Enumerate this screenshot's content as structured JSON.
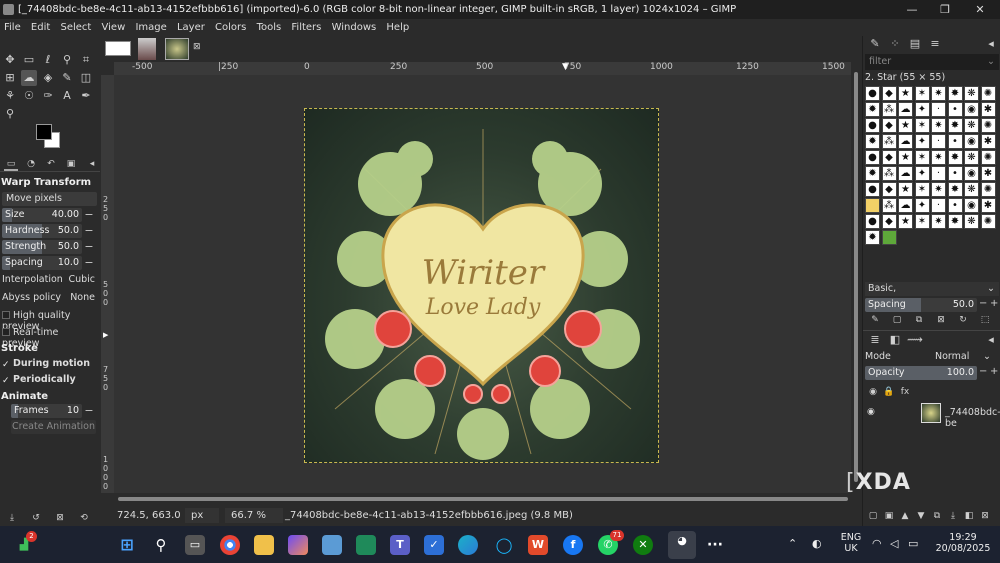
{
  "window": {
    "title": "[_74408bdc-be8e-4c11-ab13-4152efbbb616] (imported)-6.0 (RGB color 8-bit non-linear integer, GIMP built-in sRGB, 1 layer) 1024x1024 – GIMP",
    "minimize_icon": "minimize-icon",
    "maximize_icon": "maximize-icon",
    "close_icon": "close-icon"
  },
  "menu": [
    "File",
    "Edit",
    "Select",
    "View",
    "Image",
    "Layer",
    "Colors",
    "Tools",
    "Filters",
    "Windows",
    "Help"
  ],
  "tool_options": {
    "title": "Warp Transform",
    "mode": "Move pixels",
    "size": {
      "label": "Size",
      "value": "40.00",
      "level": 0.12
    },
    "hardness": {
      "label": "Hardness",
      "value": "50.0",
      "level": 0.5
    },
    "strength": {
      "label": "Strength",
      "value": "50.0",
      "level": 0.5
    },
    "spacing": {
      "label": "Spacing",
      "value": "10.0",
      "level": 0.1
    },
    "interpolation": {
      "label": "Interpolation",
      "value": "Cubic"
    },
    "abyss": {
      "label": "Abyss policy",
      "value": "None"
    },
    "hq_preview": "High quality preview",
    "rt_preview": "Real-time preview",
    "stroke_head": "Stroke",
    "during_motion": "During motion",
    "periodically": "Periodically",
    "animate_head": "Animate",
    "frames": {
      "label": "Frames",
      "value": "10",
      "level": 0.1
    },
    "create_animation": "Create Animation"
  },
  "ruler_top": [
    "-500",
    "|250",
    "0",
    "250",
    "500",
    "750",
    "1000",
    "1250",
    "1500"
  ],
  "ruler_left": [
    "2",
    "5",
    "0",
    "5",
    "0",
    "0",
    "7",
    "5",
    "0",
    "1",
    "0",
    "0",
    "0"
  ],
  "image": {
    "text_line1": "Wiriter",
    "text_line2": "Love Lady"
  },
  "status": {
    "coords": "724.5, 663.0",
    "unit": "px",
    "zoom": "66.7 %",
    "file": "_74408bdc-be8e-4c11-ab13-4152efbbb616.jpeg (9.8 MB)"
  },
  "right_panel": {
    "filter_placeholder": "filter",
    "brush_name": "2. Star (55 × 55)",
    "preset": "Basic,",
    "spacing": {
      "label": "Spacing",
      "value": "50.0",
      "level": 0.5
    },
    "mode_label": "Mode",
    "mode_value": "Normal",
    "opacity": {
      "label": "Opacity",
      "value": "100.0",
      "level": 1.0
    },
    "layer_name": "_74408bdc-be"
  },
  "taskbar": {
    "badge1": "2",
    "badge2": "71",
    "lang1": "ENG",
    "lang2": "UK",
    "time": "19:29",
    "date": "20/08/2025"
  },
  "watermark": "XDA",
  "colors": {
    "accent": "#5a5f66",
    "bg": "#2b2b2b",
    "taskbar": "#1c2230"
  }
}
